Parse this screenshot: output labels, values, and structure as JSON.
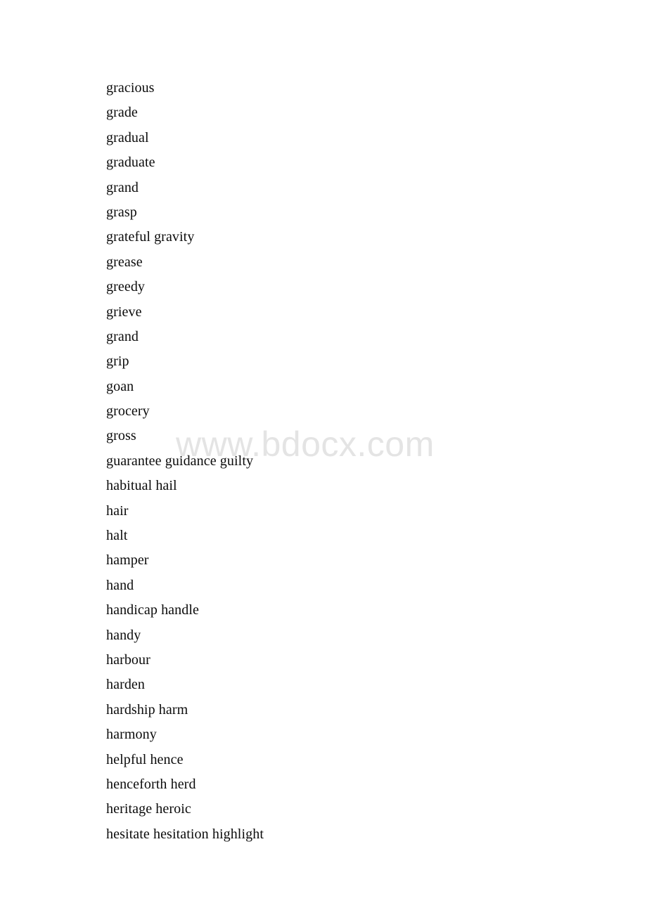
{
  "document": {
    "background_color": "#ffffff",
    "text_color": "#0b0b0b",
    "watermark": {
      "text": "www.bdocx.com",
      "color": "#e4e4e4"
    },
    "word_lines": [
      "gracious",
      "grade",
      "gradual",
      "graduate",
      "grand",
      "grasp",
      "grateful gravity",
      "grease",
      "greedy",
      "grieve",
      "grand",
      "grip",
      "goan",
      "grocery",
      "gross",
      "guarantee guidance guilty",
      "habitual hail",
      "hair",
      "halt",
      "hamper",
      "hand",
      "handicap handle",
      "handy",
      "harbour",
      "harden",
      "hardship harm",
      "harmony",
      "helpful hence",
      "henceforth herd",
      "heritage heroic",
      "hesitate hesitation highlight"
    ]
  }
}
